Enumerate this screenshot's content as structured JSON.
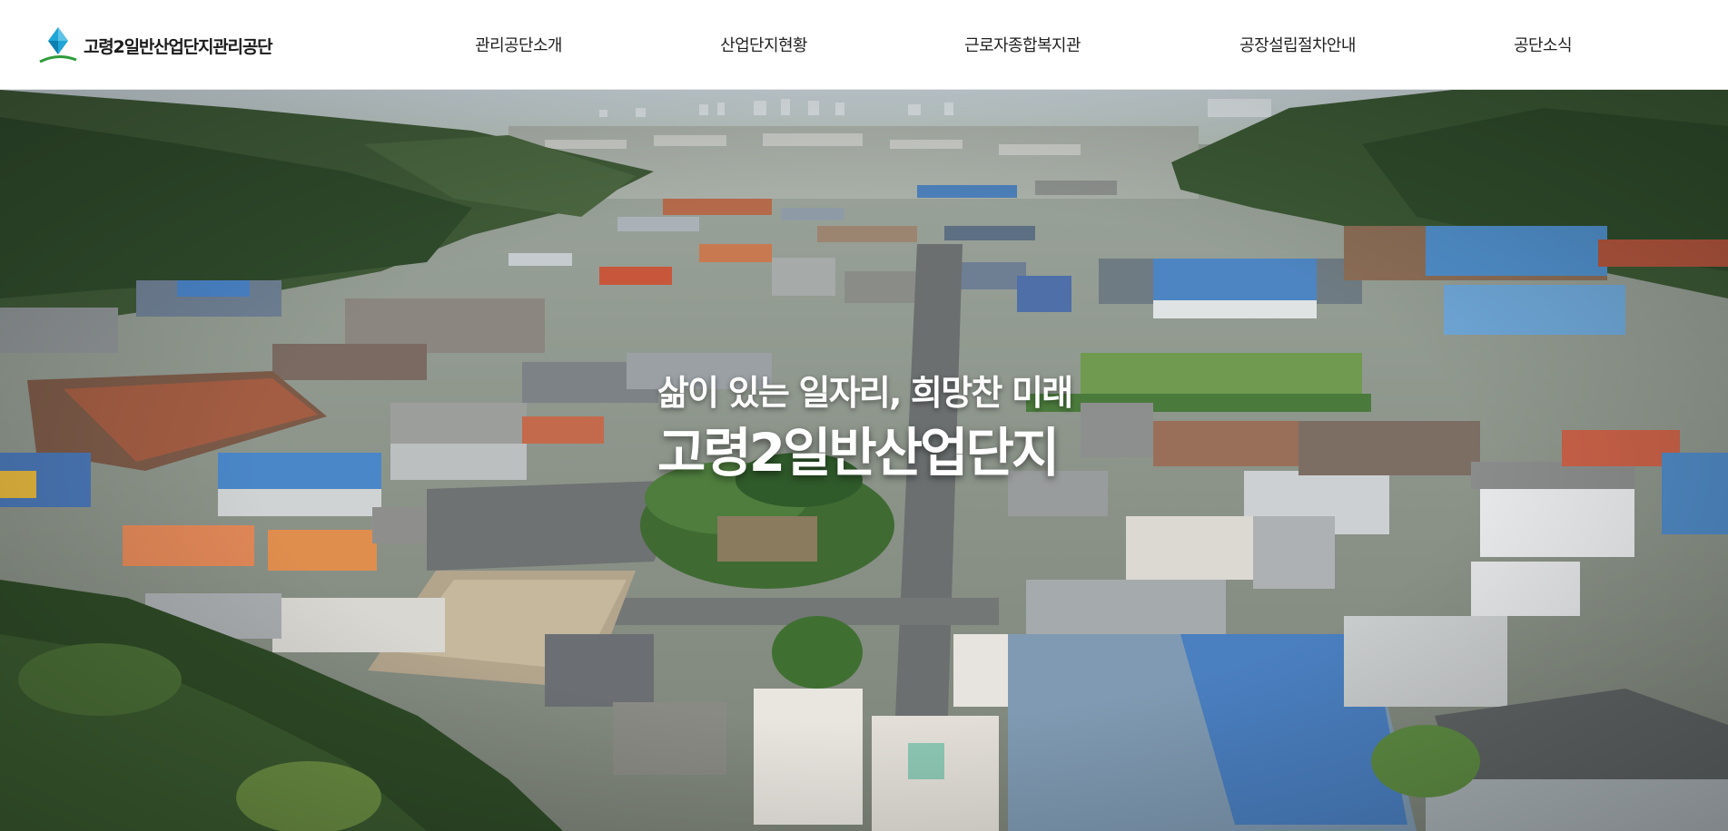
{
  "header": {
    "logo_text": "고령2일반산업단지관리공단",
    "nav": [
      {
        "label": "관리공단소개"
      },
      {
        "label": "산업단지현황"
      },
      {
        "label": "근로자종합복지관"
      },
      {
        "label": "공장설립절차안내"
      },
      {
        "label": "공단소식"
      }
    ]
  },
  "hero": {
    "subtitle": "삶이 있는 일자리, 희망찬 미래",
    "title": "고령2일반산업단지"
  },
  "colors": {
    "logo_blue": "#1fa6d6",
    "logo_green": "#2e9b3a",
    "forest": "#3e5a34",
    "roof_blue": "#5b8fc4",
    "roof_orange": "#c7683a"
  },
  "icons": {
    "logo": "diamond-logo-icon"
  }
}
